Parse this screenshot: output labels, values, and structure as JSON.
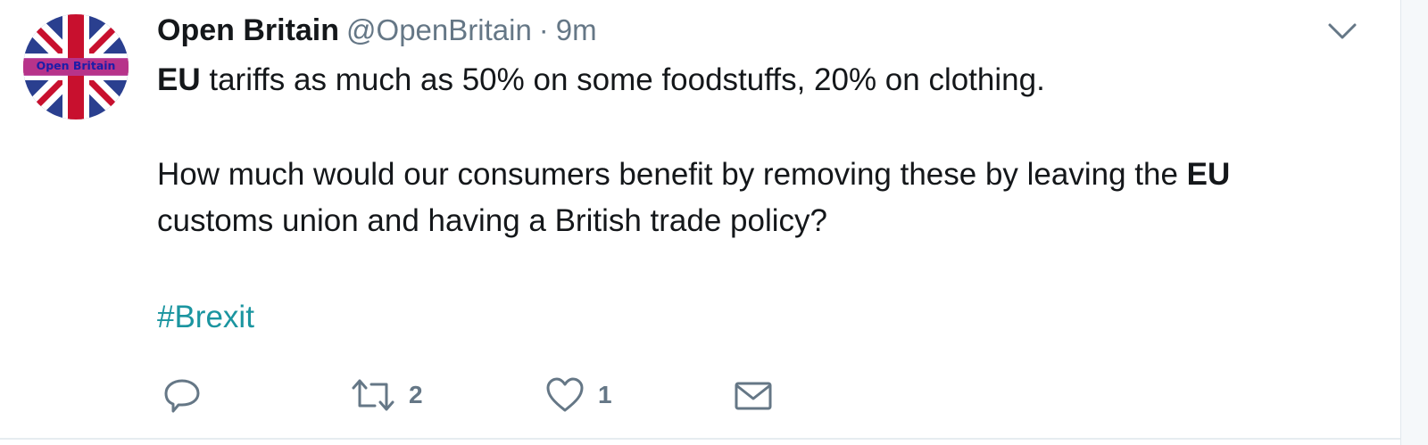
{
  "tweet": {
    "author_name": "Open Britain",
    "handle": "@OpenBritain",
    "separator": "·",
    "time": "9m",
    "avatar_text": "Open Britain",
    "line1": {
      "keyword": "EU",
      "rest": " tariffs as much as 50% on some foodstuffs, 20% on clothing."
    },
    "line2": {
      "before": "How much would our consumers benefit by removing these by leaving the ",
      "keyword": "EU"
    },
    "line3": "customs union and having a British trade policy?",
    "hashtag": "#Brexit"
  },
  "actions": {
    "reply_icon": "reply-icon",
    "retweet_icon": "retweet-icon",
    "retweet_count": "2",
    "like_icon": "heart-icon",
    "like_count": "1",
    "dm_icon": "envelope-icon"
  },
  "colors": {
    "text": "#14171a",
    "muted": "#657786",
    "hashtag": "#1b95a0"
  }
}
